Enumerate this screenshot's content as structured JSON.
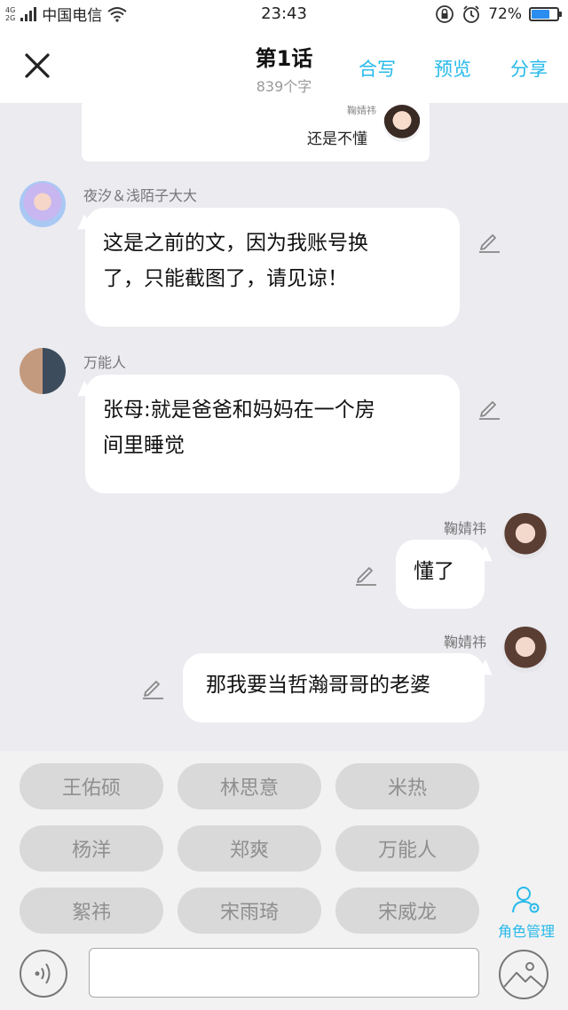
{
  "status_bar": {
    "network_top": "4G",
    "network_bottom": "2G",
    "carrier": "中国电信",
    "time": "23:43",
    "battery_percent_label": "72%",
    "battery_level": 0.72
  },
  "header": {
    "title": "第1话",
    "subtitle": "839个字",
    "actions": [
      "合写",
      "预览",
      "分享"
    ]
  },
  "preview_card": {
    "name": "鞠婧祎",
    "text": "还是不懂"
  },
  "messages": [
    {
      "side": "left",
      "name": "夜汐＆浅陌子大大",
      "lines": [
        "这是之前的文，因为我账号换",
        "了，只能截图了，请见谅！"
      ]
    },
    {
      "side": "left",
      "name": "万能人",
      "lines": [
        "张母:就是爸爸和妈妈在一个房",
        "间里睡觉"
      ]
    },
    {
      "side": "right",
      "name": "鞠婧祎",
      "lines": [
        "懂了"
      ]
    },
    {
      "side": "right",
      "name": "鞠婧祎",
      "lines": [
        "那我要当哲瀚哥哥的老婆"
      ]
    }
  ],
  "characters": [
    "王佑硕",
    "林思意",
    "米热",
    "杨洋",
    "郑爽",
    "万能人",
    "絮祎",
    "宋雨琦",
    "宋威龙"
  ],
  "role_manager_label": "角色管理",
  "input": {
    "value": "",
    "placeholder": ""
  },
  "colors": {
    "accent": "#26b9ea",
    "chat_bg": "#ebebf0",
    "chip_bg": "#d9d9d9"
  }
}
